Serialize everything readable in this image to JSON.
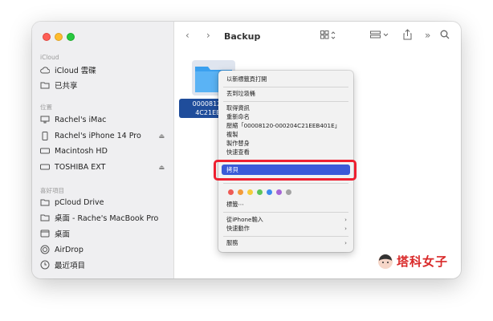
{
  "toolbar": {
    "title": "Backup"
  },
  "sidebar": {
    "sections": [
      {
        "label": "iCloud",
        "items": [
          {
            "label": "iCloud 雲碟",
            "icon": "cloud-icon"
          },
          {
            "label": "已共享",
            "icon": "shared-folder-icon"
          }
        ]
      },
      {
        "label": "位置",
        "items": [
          {
            "label": "Rachel's iMac",
            "icon": "imac-icon"
          },
          {
            "label": "Rachel's iPhone 14 Pro",
            "icon": "iphone-icon",
            "eject": "⏏"
          },
          {
            "label": "Macintosh HD",
            "icon": "disk-icon"
          },
          {
            "label": "TOSHIBA EXT",
            "icon": "disk-icon",
            "eject": "⏏"
          }
        ]
      },
      {
        "label": "喜好項目",
        "items": [
          {
            "label": "pCloud Drive",
            "icon": "folder-icon"
          },
          {
            "label": "桌面 - Rache's MacBook Pro",
            "icon": "folder-icon"
          },
          {
            "label": "桌面",
            "icon": "desktop-icon"
          },
          {
            "label": "AirDrop",
            "icon": "airdrop-icon"
          },
          {
            "label": "最近項目",
            "icon": "clock-icon"
          }
        ]
      }
    ]
  },
  "content": {
    "file_name_line1": "00008120-0",
    "file_name_line2": "4C21EEB4"
  },
  "context_menu": {
    "items": [
      "以新標籤頁打開",
      "丟到垃圾桶",
      "取得資訊",
      "重新命名",
      "壓縮「00008120-000204C21EEB401E」",
      "複製",
      "製作替身",
      "快速查看",
      "拷貝",
      "標籤⋯",
      "從iPhone輸入",
      "快速動作",
      "服務"
    ],
    "selected": "拷貝",
    "tag_colors": [
      "#ee5a55",
      "#f39a3a",
      "#f5cc3b",
      "#5cc45a",
      "#3c8af0",
      "#a565d6",
      "#a3a3a3"
    ]
  },
  "brand": {
    "text": "塔科女子"
  }
}
